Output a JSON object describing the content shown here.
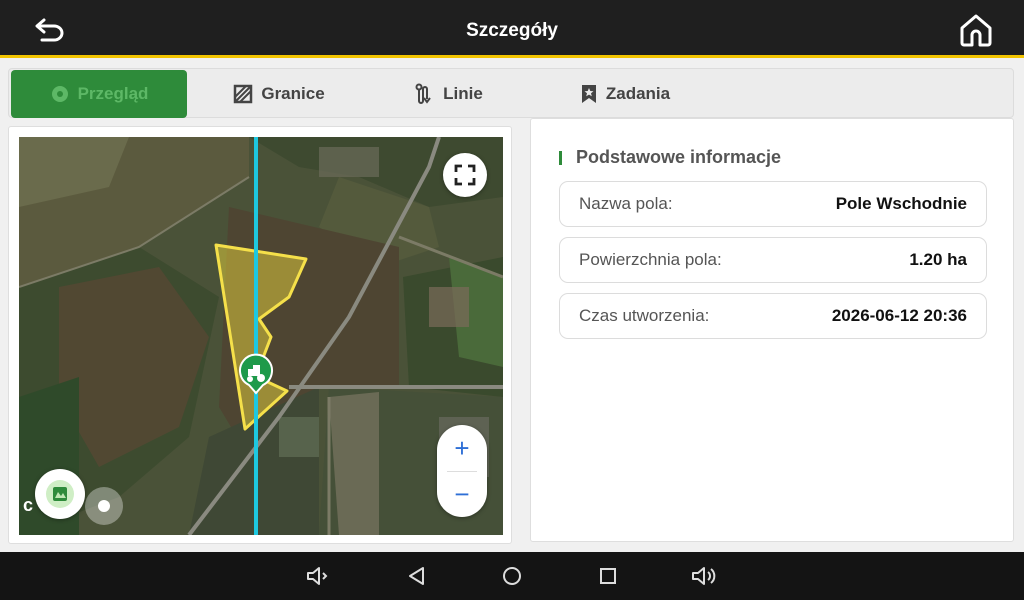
{
  "header": {
    "title": "Szczegóły",
    "back_icon": "back-arrow-icon",
    "home_icon": "home-icon"
  },
  "tabs": [
    {
      "label": "Przegląd",
      "icon": "overview-icon",
      "active": true
    },
    {
      "label": "Granice",
      "icon": "boundary-icon",
      "active": false
    },
    {
      "label": "Linie",
      "icon": "lines-icon",
      "active": false
    },
    {
      "label": "Zadania",
      "icon": "tasks-icon",
      "active": false
    }
  ],
  "map": {
    "logo_text": "c      r",
    "zoom_in": "+",
    "zoom_out": "−"
  },
  "info": {
    "section_title": "Podstawowe informacje",
    "rows": [
      {
        "label": "Nazwa pola:",
        "value": "Pole Wschodnie"
      },
      {
        "label": "Powierzchnia pola:",
        "value": "1.20 ha"
      },
      {
        "label": "Czas utworzenia:",
        "value": "2026-06-12 20:36"
      }
    ]
  },
  "colors": {
    "accent_green": "#2e8b3a",
    "header_border": "#f2c400",
    "guide_line": "#1ec8e0",
    "field_outline": "#f5e04a"
  }
}
